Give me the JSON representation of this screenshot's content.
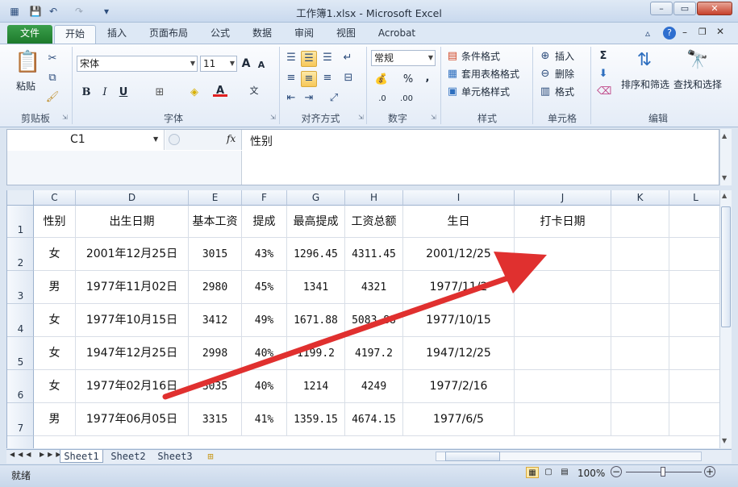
{
  "window": {
    "title": "工作簿1.xlsx - Microsoft Excel",
    "minimize": "–",
    "restore": "▭",
    "close": "✕"
  },
  "tabs": [
    "文件",
    "开始",
    "插入",
    "页面布局",
    "公式",
    "数据",
    "审阅",
    "视图",
    "Acrobat"
  ],
  "ribbon": {
    "clipboard": {
      "paste": "粘贴",
      "label": "剪贴板"
    },
    "font": {
      "name": "宋体",
      "size": "11",
      "label": "字体",
      "bold": "B",
      "italic": "I",
      "underline": "U",
      "grow": "A",
      "shrink": "A"
    },
    "alignment": {
      "label": "对齐方式"
    },
    "number": {
      "format": "常规",
      "label": "数字",
      "percent": "%",
      "comma": ",",
      "inc": ".0",
      "dec": ".00"
    },
    "styles": {
      "conditional": "条件格式",
      "table": "套用表格格式",
      "cell": "单元格样式",
      "label": "样式"
    },
    "cells": {
      "insert": "插入",
      "delete": "删除",
      "format": "格式",
      "label": "单元格"
    },
    "editing": {
      "sort": "排序和筛选",
      "find": "查找和选择",
      "sum": "Σ",
      "label": "编辑"
    }
  },
  "formula_bar": {
    "name_box": "C1",
    "fx": "fx",
    "content": "性别"
  },
  "columns": [
    "C",
    "D",
    "E",
    "F",
    "G",
    "H",
    "I",
    "J",
    "K",
    "L"
  ],
  "rows": [
    {
      "num": "1",
      "cells": [
        "性别",
        "出生日期",
        "基本工资",
        "提成",
        "最高提成",
        "工资总额",
        "生日",
        "打卡日期",
        "",
        ""
      ]
    },
    {
      "num": "2",
      "cells": [
        "女",
        "2001年12月25日",
        "3015",
        "43%",
        "1296.45",
        "4311.45",
        "2001/12/25",
        "",
        "",
        ""
      ]
    },
    {
      "num": "3",
      "cells": [
        "男",
        "1977年11月02日",
        "2980",
        "45%",
        "1341",
        "4321",
        "1977/11/2",
        "",
        "",
        ""
      ]
    },
    {
      "num": "4",
      "cells": [
        "女",
        "1977年10月15日",
        "3412",
        "49%",
        "1671.88",
        "5083.88",
        "1977/10/15",
        "",
        "",
        ""
      ]
    },
    {
      "num": "5",
      "cells": [
        "女",
        "1947年12月25日",
        "2998",
        "40%",
        "1199.2",
        "4197.2",
        "1947/12/25",
        "",
        "",
        ""
      ]
    },
    {
      "num": "6",
      "cells": [
        "女",
        "1977年02月16日",
        "3035",
        "40%",
        "1214",
        "4249",
        "1977/2/16",
        "",
        "",
        ""
      ]
    },
    {
      "num": "7",
      "cells": [
        "男",
        "1977年06月05日",
        "3315",
        "41%",
        "1359.15",
        "4674.15",
        "1977/6/5",
        "",
        "",
        ""
      ]
    }
  ],
  "sheets": [
    "Sheet1",
    "Sheet2",
    "Sheet3"
  ],
  "status": {
    "ready": "就绪",
    "zoom": "100%"
  },
  "colors": {
    "file_tab": "#1d7a2c",
    "arrow": "#e0302f",
    "selected_highlight": "#f7c85a"
  }
}
